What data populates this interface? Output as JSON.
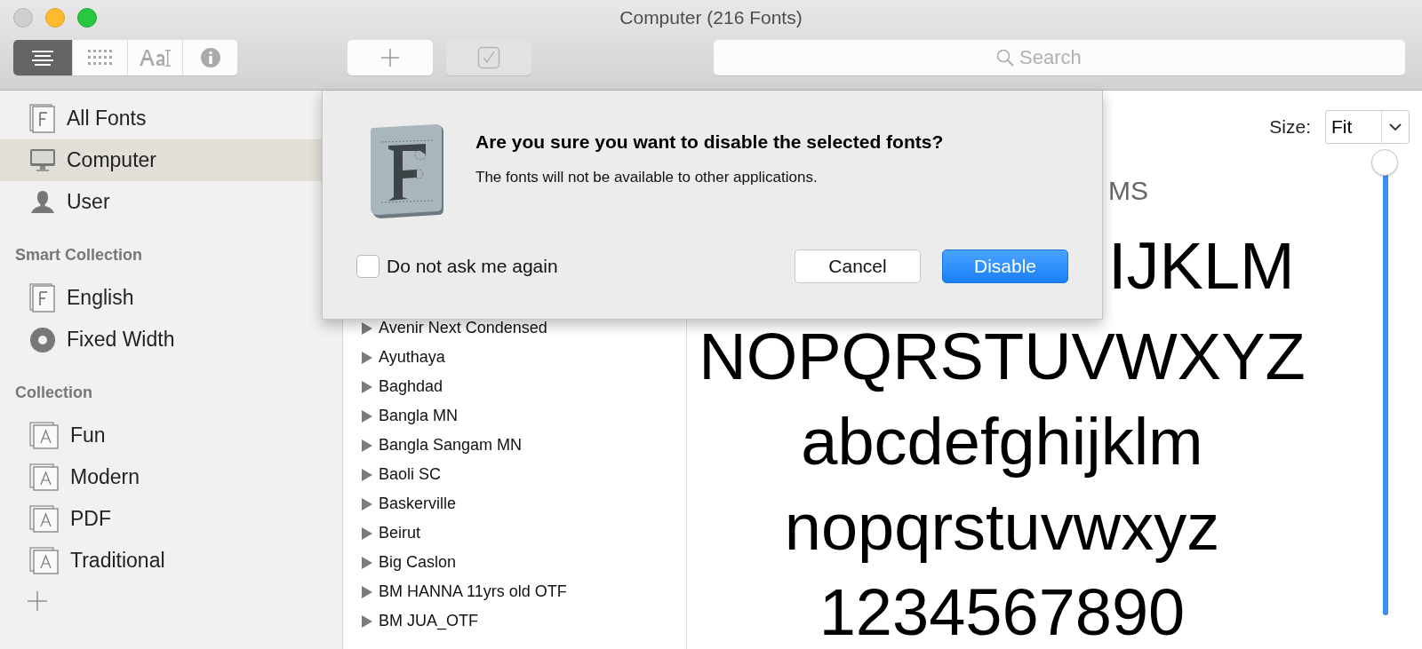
{
  "window": {
    "title": "Computer (216 Fonts)"
  },
  "toolbar": {
    "view_modes": [
      {
        "kind": "list",
        "selected": true
      },
      {
        "kind": "grid",
        "selected": false
      },
      {
        "kind": "sample",
        "selected": false
      },
      {
        "kind": "info",
        "selected": false
      }
    ],
    "add_button": {
      "disabled": false
    },
    "enable_button": {
      "disabled": true
    },
    "search": {
      "placeholder": "Search"
    }
  },
  "sidebar": {
    "groups": [
      {
        "items": [
          {
            "label": "All Fonts",
            "kind": "font",
            "selected": false
          },
          {
            "label": "Computer",
            "kind": "computer",
            "selected": true
          },
          {
            "label": "User",
            "kind": "user",
            "selected": false
          }
        ]
      },
      {
        "heading": "Smart Collection",
        "items": [
          {
            "label": "English",
            "kind": "font",
            "selected": false
          },
          {
            "label": "Fixed Width",
            "kind": "smart",
            "selected": false
          }
        ]
      },
      {
        "heading": "Collection",
        "items": [
          {
            "label": "Fun",
            "kind": "collection",
            "selected": false
          },
          {
            "label": "Modern",
            "kind": "collection",
            "selected": false
          },
          {
            "label": "PDF",
            "kind": "collection",
            "selected": false
          },
          {
            "label": "Traditional",
            "kind": "collection",
            "selected": false
          }
        ]
      }
    ]
  },
  "font_list": [
    "Avenir Next Condensed",
    "Ayuthaya",
    "Baghdad",
    "Bangla MN",
    "Bangla Sangam MN",
    "Baoli SC",
    "Baskerville",
    "Beirut",
    "Big Caslon",
    "BM HANNA 11yrs old OTF",
    "BM JUA_OTF"
  ],
  "preview": {
    "font_name": "MS",
    "size_label": "Size:",
    "size_value": "Fit",
    "size_slider": {
      "level": 1
    },
    "lines": [
      "IJKLM",
      "NOPQRSTUVWXYZ",
      "abcdefghijklm",
      "nopqrstuvwxyz",
      "1234567890"
    ]
  },
  "dialog": {
    "title": "Are you sure you want to disable the selected fonts?",
    "message": "The fonts will not be available to other applications.",
    "checkbox": {
      "label": "Do not ask me again",
      "checked": false
    },
    "buttons": [
      {
        "label": "Cancel",
        "kind": "secondary"
      },
      {
        "label": "Disable",
        "kind": "primary"
      }
    ]
  }
}
